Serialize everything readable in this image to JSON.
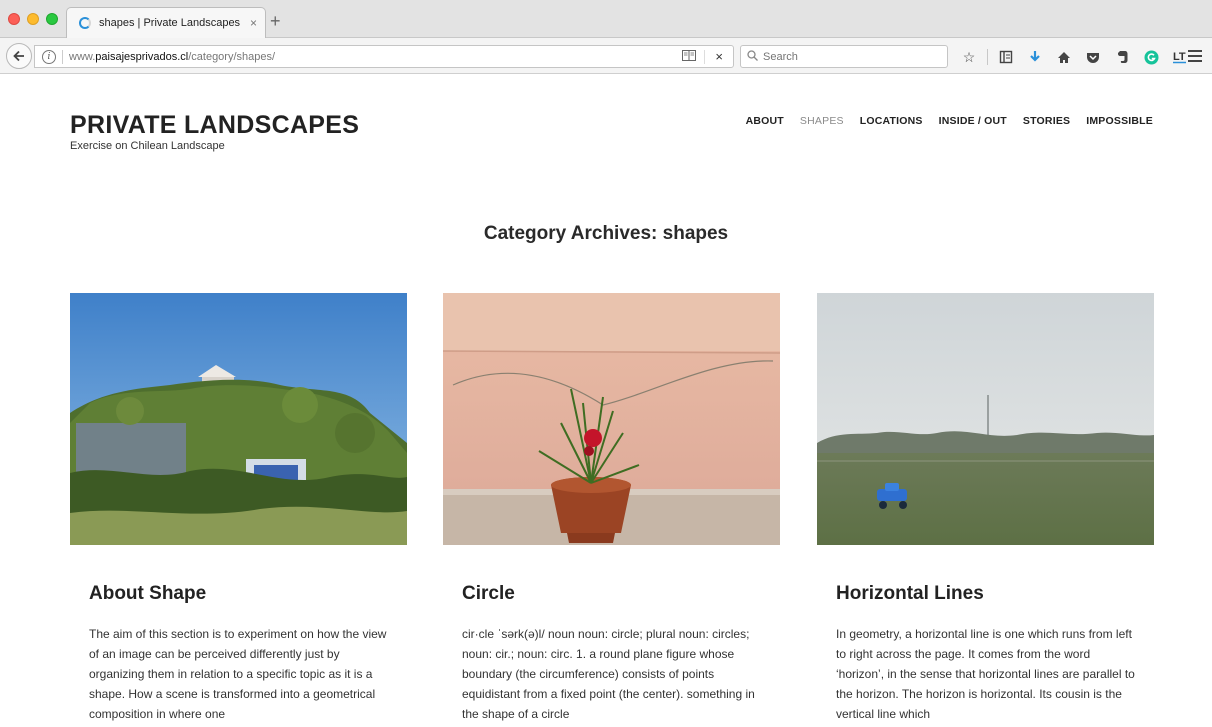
{
  "browser": {
    "tab_title": "shapes | Private Landscapes",
    "tab_close": "×",
    "new_tab": "+",
    "url_prefix": "www.",
    "url_domain": "paisajesprivados.cl",
    "url_path": "/category/shapes/",
    "search_placeholder": "Search",
    "stop_label": "×"
  },
  "site": {
    "title": "PRIVATE LANDSCAPES",
    "tagline": "Exercise on Chilean Landscape"
  },
  "nav": {
    "items": [
      {
        "label": "ABOUT"
      },
      {
        "label": "SHAPES"
      },
      {
        "label": "LOCATIONS"
      },
      {
        "label": "INSIDE / OUT"
      },
      {
        "label": "STORIES"
      },
      {
        "label": "IMPOSSIBLE"
      }
    ],
    "active_index": 1
  },
  "archive": {
    "title": "Category Archives: shapes"
  },
  "posts": [
    {
      "title": "About Shape",
      "excerpt": "The aim of this section is to experiment on how the view of an image can be perceived differently just by organizing them in relation to a specific topic as it is a shape. How a scene is transformed into a geometrical composition in where one",
      "image": "overgrown-wall-photo"
    },
    {
      "title": "Circle",
      "excerpt": "cir·cle ˈsərk(ə)l/ noun noun: circle; plural noun: circles; noun: cir.; noun: circ. 1. a round plane figure whose boundary (the circumference) consists of points equidistant from a fixed point (the center). something in the shape of a circle",
      "image": "potted-plant-photo"
    },
    {
      "title": "Horizontal Lines",
      "excerpt": "In geometry, a horizontal line is one which runs from left to right across the page. It comes from the word ‘horizon’, in the sense that horizontal lines are parallel to the horizon. The horizon is horizontal. Its cousin is the vertical line which",
      "image": "misty-field-photo"
    }
  ],
  "colors": {
    "nav_active": "#8a8a8a",
    "text_dark": "#222222",
    "accent_blue": "#2a90d9"
  }
}
